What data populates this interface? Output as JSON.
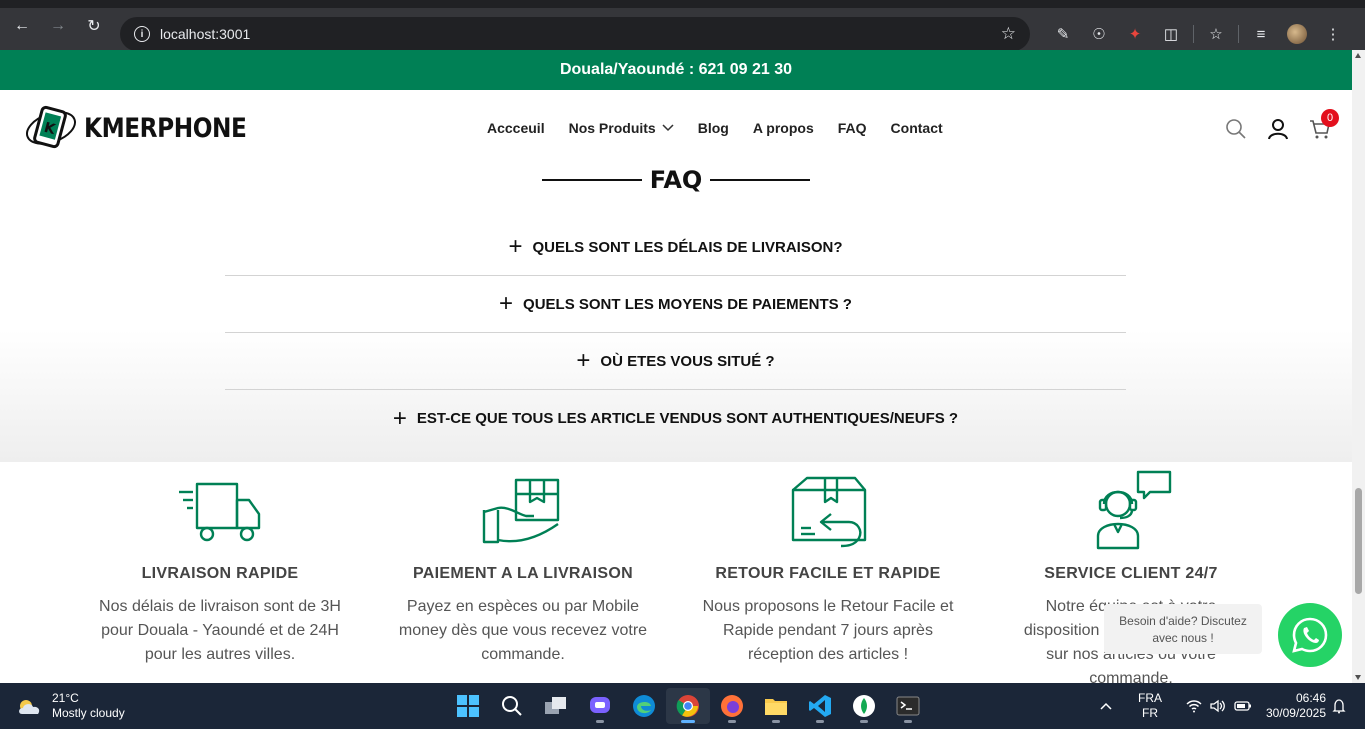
{
  "browser": {
    "url": "localhost:3001"
  },
  "site": {
    "banner": "Douala/Yaoundé : 621 09 21 30",
    "logo_text": "KMERPHONE",
    "menu": [
      "Accceuil",
      "Nos Produits",
      "Blog",
      "A propos",
      "FAQ",
      "Contact"
    ],
    "cart_count": "0"
  },
  "faq": {
    "title": "FAQ",
    "items": [
      "QUELS SONT LES DÉLAIS DE LIVRAISON?",
      "QUELS SONT LES MOYENS DE PAIEMENTS ?",
      "OÙ ETES VOUS SITUÉ ?",
      "EST-CE QUE TOUS LES ARTICLE VENDUS SONT AUTHENTIQUES/NEUFS ?"
    ]
  },
  "features": [
    {
      "title": "LIVRAISON RAPIDE",
      "icon": "delivery-truck-icon",
      "lines": [
        "Nos délais de livraison sont de 3H",
        "pour Douala - Yaoundé et de 24H",
        "pour les autres villes."
      ]
    },
    {
      "title": "PAIEMENT A LA LIVRAISON",
      "icon": "hand-box-icon",
      "lines": [
        "Payez en espèces ou par Mobile",
        "money dès que vous recevez votre",
        "commande."
      ]
    },
    {
      "title": "RETOUR FACILE ET RAPIDE",
      "icon": "return-box-icon",
      "lines": [
        "Nous proposons le Retour Facile et",
        "Rapide pendant 7 jours après",
        "réception des articles !"
      ]
    },
    {
      "title": "SERVICE CLIENT 24/7",
      "icon": "support-agent-icon",
      "lines": [
        "Notre équipe est à votre",
        "disposition pour vos questions",
        "sur nos articles ou votre",
        "commande."
      ]
    }
  ],
  "chat": {
    "line1": "Besoin d'aide? Discutez",
    "line2": "avec nous !"
  },
  "taskbar": {
    "temp": "21°C",
    "weather": "Mostly cloudy",
    "lang_top": "FRA",
    "lang_bottom": "FR",
    "time": "06:46",
    "date": "30/09/2025"
  },
  "colors": {
    "brand_green": "#008055",
    "whatsapp": "#25d366",
    "badge": "#e3101d"
  }
}
